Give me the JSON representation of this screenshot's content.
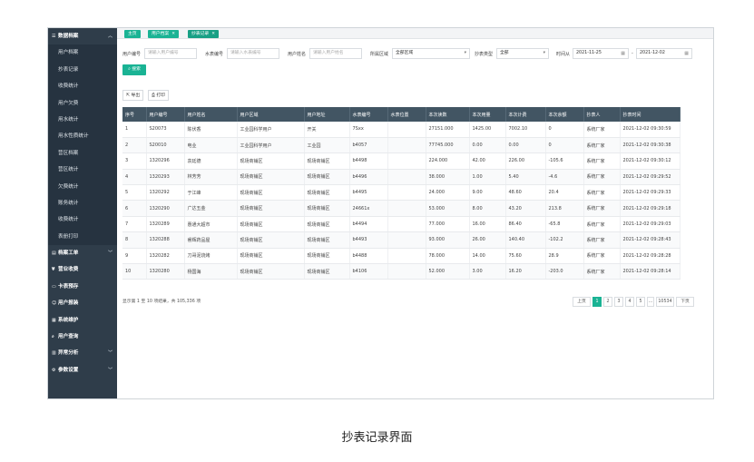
{
  "sidebar": {
    "items": [
      {
        "label": "数据档案",
        "icon": "list-icon",
        "glyph": "☰",
        "type": "top",
        "caret": "︿"
      },
      {
        "label": "用户档案",
        "type": "sub"
      },
      {
        "label": "抄表记录",
        "type": "sub"
      },
      {
        "label": "收费统计",
        "type": "sub"
      },
      {
        "label": "用户欠费",
        "type": "sub"
      },
      {
        "label": "用水统计",
        "type": "sub"
      },
      {
        "label": "用水性质统计",
        "type": "sub"
      },
      {
        "label": "营区档案",
        "type": "sub"
      },
      {
        "label": "营区统计",
        "type": "sub"
      },
      {
        "label": "欠费统计",
        "type": "sub"
      },
      {
        "label": "账务统计",
        "type": "sub"
      },
      {
        "label": "收费统计",
        "type": "sub"
      },
      {
        "label": "表册打印",
        "type": "sub"
      },
      {
        "label": "档案工单",
        "icon": "file-icon",
        "glyph": "▤",
        "type": "top",
        "caret": "﹀"
      },
      {
        "label": "营业收费",
        "icon": "money-icon",
        "glyph": "¥",
        "type": "top",
        "caret": ""
      },
      {
        "label": "卡表预存",
        "icon": "card-icon",
        "glyph": "▭",
        "type": "top",
        "caret": ""
      },
      {
        "label": "用户报装",
        "icon": "user-add-icon",
        "glyph": "☺",
        "type": "top",
        "caret": ""
      },
      {
        "label": "系统维护",
        "icon": "wrench-icon",
        "glyph": "▦",
        "type": "top",
        "caret": ""
      },
      {
        "label": "用户查询",
        "icon": "search-icon",
        "glyph": "⌕",
        "type": "top",
        "caret": ""
      },
      {
        "label": "异常分析",
        "icon": "chart-icon",
        "glyph": "▥",
        "type": "top",
        "caret": "﹀"
      },
      {
        "label": "参数设置",
        "icon": "settings-icon",
        "glyph": "⚙",
        "type": "top",
        "caret": "﹀"
      }
    ]
  },
  "tabs": [
    {
      "label": "主页",
      "closable": false
    },
    {
      "label": "用户档案",
      "closable": true
    },
    {
      "label": "抄表记录",
      "closable": true
    }
  ],
  "filters": {
    "user_no_label": "用户编号",
    "user_no_placeholder": "请输入用户编号",
    "meter_no_label": "水表编号",
    "meter_no_placeholder": "请输入水表编号",
    "user_name_label": "用户姓名",
    "user_name_placeholder": "请输入用户姓名",
    "area_label": "所属区域",
    "area_value": "全部区域",
    "type_label": "抄表类型",
    "type_value": "全部",
    "time_label": "时间从",
    "date_from": "2021-11-25",
    "date_sep": "-",
    "date_to": "2021-12-02",
    "search_label": "搜索",
    "search_icon": "search-icon"
  },
  "toolbar": {
    "export_label": "导出",
    "print_label": "打印"
  },
  "table": {
    "columns": [
      "序号",
      "用户编号",
      "用户姓名",
      "用户区域",
      "用户地址",
      "水表编号",
      "水表位置",
      "本次读数",
      "本次用量",
      "本次计费",
      "本次余额",
      "抄表人",
      "抄表时间"
    ],
    "rows": [
      [
        "1",
        "S20073",
        "陈伏香",
        "工业园科学用户",
        "开关",
        "7Sxx",
        "",
        "27151.000",
        "1425.00",
        "7002.10",
        "0",
        "系统厂家",
        "2021-12-02 09:30:59"
      ],
      [
        "2",
        "S20010",
        "电业",
        "工业园科学用户",
        "工业园",
        "b4057",
        "",
        "77745.000",
        "0.00",
        "0.00",
        "0",
        "系统厂家",
        "2021-12-02 09:30:38"
      ],
      [
        "3",
        "1320296",
        "袁廷德",
        "现场商铺区",
        "现场商铺区",
        "b4498",
        "",
        "224.000",
        "42.00",
        "226.00",
        "-105.6",
        "系统厂家",
        "2021-12-02 09:30:12"
      ],
      [
        "4",
        "1320293",
        "林芳芳",
        "现场商铺区",
        "现场商铺区",
        "b4496",
        "",
        "38.000",
        "1.00",
        "5.40",
        "-4.6",
        "系统厂家",
        "2021-12-02 09:29:52"
      ],
      [
        "5",
        "1320292",
        "于江峰",
        "现场商铺区",
        "现场商铺区",
        "b4495",
        "",
        "24.000",
        "9.00",
        "48.60",
        "20.4",
        "系统厂家",
        "2021-12-02 09:29:33"
      ],
      [
        "6",
        "1320290",
        "广达五金",
        "现场商铺区",
        "现场商铺区",
        "24661x",
        "",
        "53.000",
        "8.00",
        "43.20",
        "213.8",
        "系统厂家",
        "2021-12-02 09:29:18"
      ],
      [
        "7",
        "1320289",
        "惠通大超市",
        "现场商铺区",
        "现场商铺区",
        "b4494",
        "",
        "77.000",
        "16.00",
        "86.40",
        "-65.8",
        "系统厂家",
        "2021-12-02 09:29:03"
      ],
      [
        "8",
        "1320288",
        "睿辉药品屋",
        "现场商铺区",
        "现场商铺区",
        "b4493",
        "",
        "93.000",
        "26.00",
        "140.40",
        "-102.2",
        "系统厂家",
        "2021-12-02 09:28:43"
      ],
      [
        "9",
        "1320282",
        "刀哥泥烧烤",
        "现场商铺区",
        "现场商铺区",
        "b4488",
        "",
        "78.000",
        "14.00",
        "75.60",
        "28.9",
        "系统厂家",
        "2021-12-02 09:28:28"
      ],
      [
        "10",
        "1320280",
        "杨国海",
        "现场商铺区",
        "现场商铺区",
        "b4106",
        "",
        "52.000",
        "3.00",
        "16.20",
        "-203.0",
        "系统厂家",
        "2021-12-02 09:28:14"
      ]
    ]
  },
  "footer": {
    "summary": "显示第 1 至 10 项结果，共 105,336 项"
  },
  "pagination": {
    "prev": "上页",
    "pages": [
      "1",
      "2",
      "3",
      "4",
      "5"
    ],
    "ellipsis": "…",
    "last": "10534",
    "next": "下页",
    "current": "1"
  },
  "caption": "抄表记录界面",
  "colors": {
    "accent": "#1ab394",
    "sidebar": "#2f3d4a",
    "table_header": "#425563"
  }
}
